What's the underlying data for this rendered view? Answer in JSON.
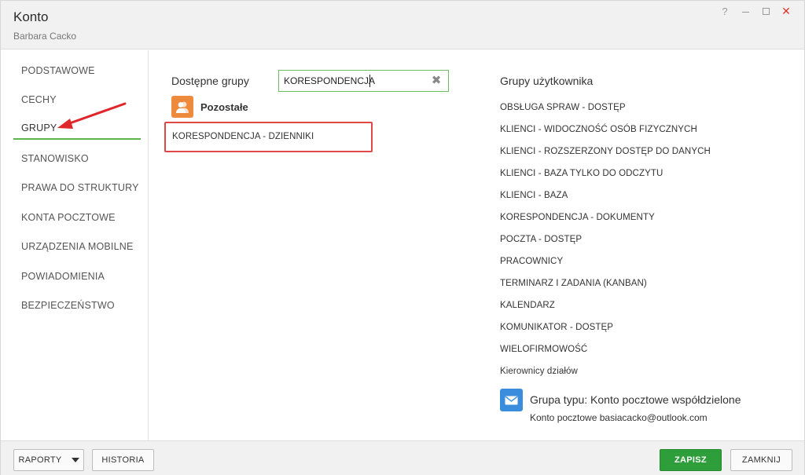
{
  "window": {
    "title": "Konto",
    "subtitle": "Barbara Cacko",
    "controls": {
      "help": "?",
      "minimize": "minimize",
      "maximize": "maximize",
      "close": "✕"
    }
  },
  "sidebar": {
    "items": [
      {
        "label": "PODSTAWOWE",
        "active": false
      },
      {
        "label": "CECHY",
        "active": false
      },
      {
        "label": "GRUPY",
        "active": true
      },
      {
        "label": "STANOWISKO",
        "active": false
      },
      {
        "label": "PRAWA DO STRUKTURY",
        "active": false
      },
      {
        "label": "KONTA POCZTOWE",
        "active": false
      },
      {
        "label": "URZĄDZENIA MOBILNE",
        "active": false
      },
      {
        "label": "POWIADOMIENIA",
        "active": false
      },
      {
        "label": "BEZPIECZEŃSTWO",
        "active": false
      }
    ]
  },
  "available": {
    "label": "Dostępne grupy",
    "search_value": "KORESPONDENCJA",
    "group_name": "Pozostałe",
    "results": [
      "KORESPONDENCJA - DZIENNIKI"
    ]
  },
  "user_groups": {
    "title": "Grupy użytkownika",
    "items": [
      "OBSŁUGA SPRAW - DOSTĘP",
      "KLIENCI - WIDOCZNOŚĆ OSÓB FIZYCZNYCH",
      "KLIENCI - ROZSZERZONY DOSTĘP DO DANYCH",
      "KLIENCI - BAZA TYLKO DO ODCZYTU",
      "KLIENCI - BAZA",
      "KORESPONDENCJA - DOKUMENTY",
      "POCZTA - DOSTĘP",
      "PRACOWNICY",
      "TERMINARZ I ZADANIA (KANBAN)",
      "KALENDARZ",
      "KOMUNIKATOR - DOSTĘP",
      "WIELOFIRMOWOŚĆ",
      "Kierownicy działów"
    ],
    "mail_group": {
      "title": "Grupa typu: Konto pocztowe współdzielone",
      "subtitle": "Konto pocztowe basiacacko@outlook.com"
    }
  },
  "footer": {
    "reports_label": "RAPORTY",
    "history_label": "HISTORIA",
    "save_label": "ZAPISZ",
    "close_label": "ZAMKNIJ"
  },
  "colors": {
    "accent_green": "#2e9e3b",
    "active_underline": "#5cb54d",
    "highlight_red": "#e04848",
    "group_icon_orange": "#ee8a3c",
    "mail_icon_blue": "#3a8ddc"
  },
  "icons": {
    "group": "users-icon",
    "mail": "envelope-icon",
    "clear": "clear-icon",
    "dropdown": "caret-down-icon"
  }
}
